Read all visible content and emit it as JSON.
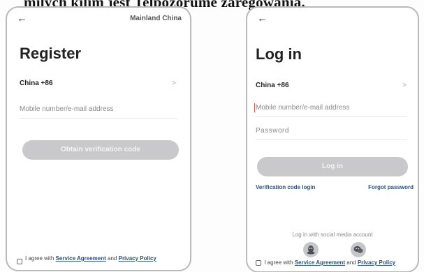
{
  "caption_fragment": "milych kilim jest Telpozorume zaregowania.",
  "register_screen": {
    "back_icon": "←",
    "region": "Mainland China",
    "title": "Register",
    "country_code": "China +86",
    "chevron": ">",
    "mobile_placeholder": "Mobile number/e-mail address",
    "submit_label": "Obtain verification code",
    "agree_prefix": "I agree with",
    "service_agreement": "Service Agreement",
    "and": "and",
    "privacy_policy": "Privacy Policy"
  },
  "login_screen": {
    "back_icon": "←",
    "title": "Log in",
    "country_code": "China +86",
    "chevron": ">",
    "mobile_placeholder": "Mobile number/e-mail address",
    "password_placeholder": "Password",
    "submit_label": "Log in",
    "verification_login": "Verification code login",
    "forgot_password": "Forgot password",
    "social_caption": "Log in with social media account",
    "social_icons": [
      "qq-icon",
      "wechat-icon"
    ],
    "agree_prefix": "I agree with",
    "service_agreement": "Service Agreement",
    "and": "and",
    "privacy_policy": "Privacy Policy"
  },
  "colors": {
    "button_disabled": "#c9c9cb",
    "link": "#2a4f86",
    "social_icon_bg": "#c4c6c9",
    "phone_border": "#b9b9b9"
  }
}
